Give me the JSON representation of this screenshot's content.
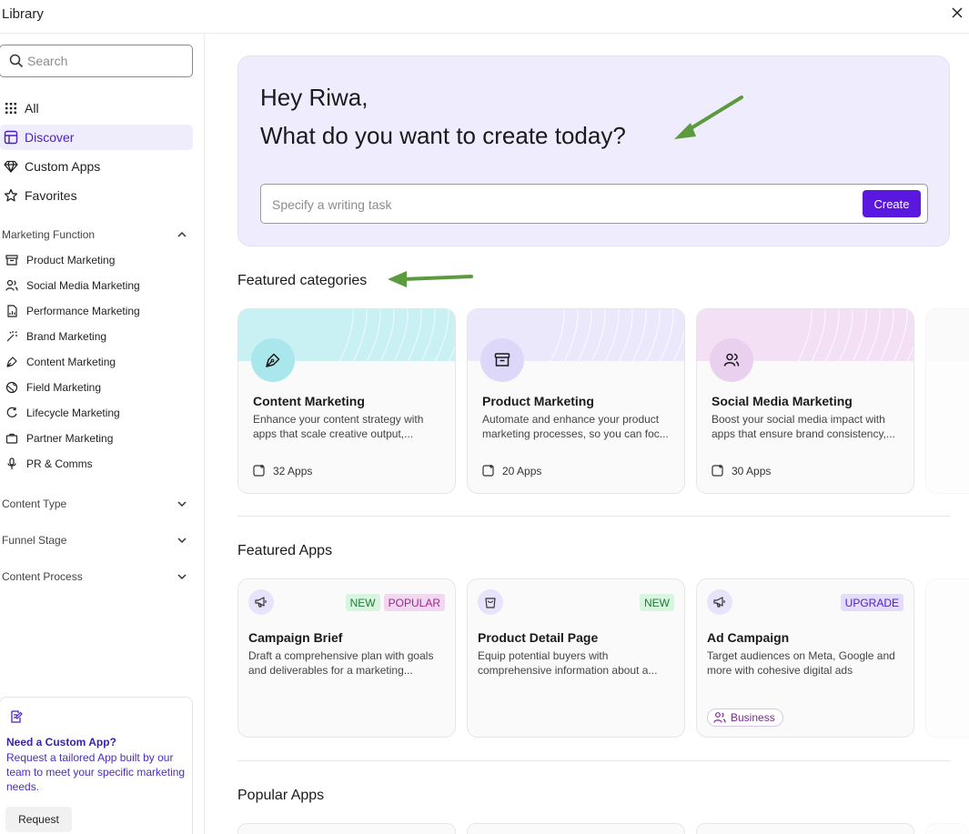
{
  "window": {
    "title": "Library"
  },
  "sidebar": {
    "search_placeholder": "Search",
    "nav": [
      {
        "label": "All",
        "icon": "grid-dots-icon"
      },
      {
        "label": "Discover",
        "icon": "layout-icon",
        "active": true
      },
      {
        "label": "Custom Apps",
        "icon": "diamond-icon"
      },
      {
        "label": "Favorites",
        "icon": "star-icon"
      }
    ],
    "sections": [
      {
        "label": "Marketing Function",
        "expanded": true,
        "items": [
          {
            "label": "Product Marketing",
            "icon": "archive-box-icon"
          },
          {
            "label": "Social Media Marketing",
            "icon": "users-icon"
          },
          {
            "label": "Performance Marketing",
            "icon": "file-chart-icon"
          },
          {
            "label": "Brand Marketing",
            "icon": "magic-wand-icon"
          },
          {
            "label": "Content Marketing",
            "icon": "pen-nib-icon"
          },
          {
            "label": "Field Marketing",
            "icon": "globe-icon"
          },
          {
            "label": "Lifecycle Marketing",
            "icon": "cycle-icon"
          },
          {
            "label": "Partner Marketing",
            "icon": "briefcase-icon"
          },
          {
            "label": "PR & Comms",
            "icon": "microphone-icon"
          }
        ]
      },
      {
        "label": "Content Type",
        "expanded": false
      },
      {
        "label": "Funnel Stage",
        "expanded": false
      },
      {
        "label": "Content Process",
        "expanded": false
      }
    ],
    "custom_app": {
      "title": "Need a Custom App?",
      "description": "Request a tailored App built by our team to meet your specific marketing needs.",
      "button": "Request"
    }
  },
  "hero": {
    "greeting": "Hey Riwa,",
    "question": "What do you want to create today?",
    "task_placeholder": "Specify a writing task",
    "create_label": "Create"
  },
  "featured_categories": {
    "heading": "Featured categories",
    "items": [
      {
        "name": "Content Marketing",
        "description": "Enhance your content strategy with apps that scale creative output,...",
        "count": "32 Apps",
        "icon": "pen-nib-icon",
        "color": "#c9f1f3"
      },
      {
        "name": "Product Marketing",
        "description": "Automate and enhance your product marketing processes, so you can foc...",
        "count": "20 Apps",
        "icon": "archive-box-icon",
        "color": "#e6e2fb"
      },
      {
        "name": "Social Media Marketing",
        "description": "Boost your social media impact with apps that ensure brand consistency,...",
        "count": "30 Apps",
        "icon": "users-icon",
        "color": "#f2ddf4"
      }
    ]
  },
  "featured_apps": {
    "heading": "Featured Apps",
    "items": [
      {
        "name": "Campaign Brief",
        "description": "Draft a comprehensive plan with goals and deliverables for a marketing...",
        "badges": [
          "NEW",
          "POPULAR"
        ],
        "icon": "megaphone-icon"
      },
      {
        "name": "Product Detail Page",
        "description": "Equip potential buyers with comprehensive information about a...",
        "badges": [
          "NEW"
        ],
        "icon": "shopping-bag-icon"
      },
      {
        "name": "Ad Campaign",
        "description": "Target audiences on Meta, Google and more with cohesive digital ads",
        "badges": [
          "UPGRADE"
        ],
        "icon": "megaphone-icon",
        "tier": "Business"
      }
    ]
  },
  "popular_apps": {
    "heading": "Popular Apps"
  },
  "colors": {
    "accent": "#5a17e0",
    "hero_bg": "#efedfd",
    "arrow": "#5b9a3e"
  }
}
